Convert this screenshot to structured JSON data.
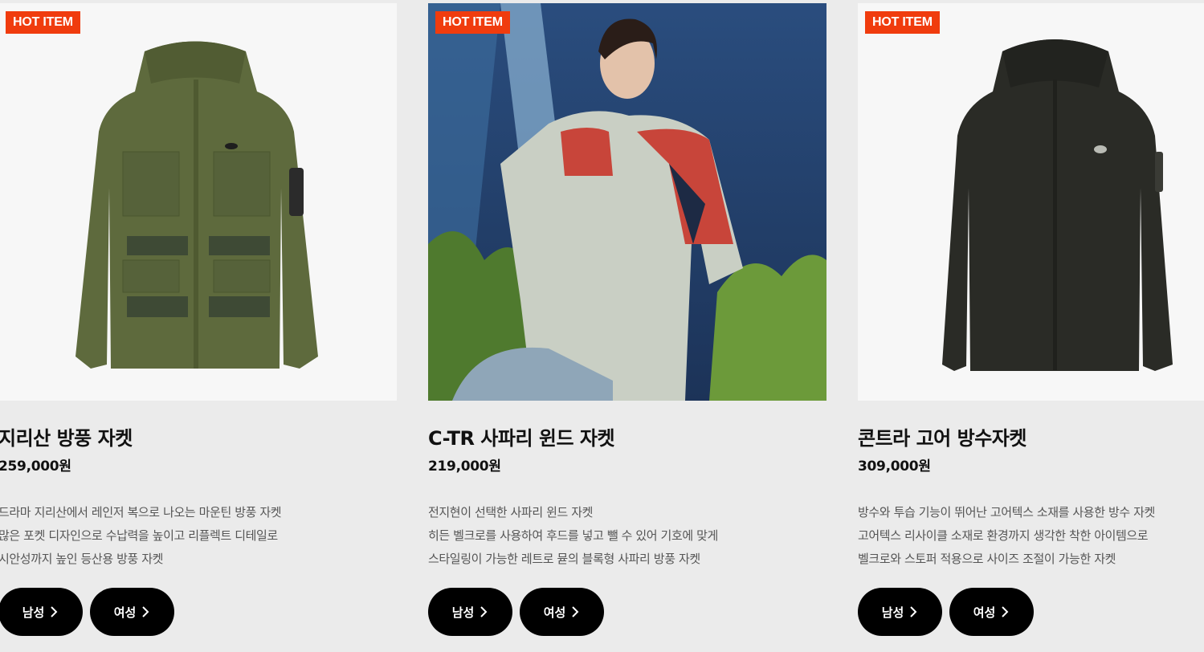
{
  "badge_color": "#f03c0e",
  "products": [
    {
      "badge": "HOT ITEM",
      "title": "지리산 방풍 자켓",
      "price": "259,000원",
      "desc": [
        "드라마 지리산에서 레인저 복으로 나오는 마운틴 방풍 자켓",
        "많은 포켓 디자인으로 수납력을 높이고 리플렉트 디테일로",
        "시안성까지 높인 등산용 방풍 자켓"
      ],
      "buttons": [
        "남성",
        "여성"
      ]
    },
    {
      "badge": "HOT ITEM",
      "title": "C-TR 사파리 윈드 자켓",
      "price": "219,000원",
      "desc": [
        "전지현이 선택한 사파리 윈드 자켓",
        "히든 벨크로를 사용하여 후드를 넣고 뺄 수 있어 기호에 맞게",
        "스타일링이 가능한 레트로 뮫의 블록형 사파리 방풍 자켓"
      ],
      "buttons": [
        "남성",
        "여성"
      ]
    },
    {
      "badge": "HOT ITEM",
      "title": "콘트라 고어 방수자켓",
      "price": "309,000원",
      "desc": [
        "방수와 투습 기능이 뛰어난 고어텍스 소재를 사용한 방수 자켓",
        "고어텍스 리사이클 소재로 환경까지 생각한 착한 아이템으로",
        "벨크로와 스토퍼 적용으로 사이즈 조절이 가능한 자켓"
      ],
      "buttons": [
        "남성",
        "여성"
      ]
    }
  ]
}
